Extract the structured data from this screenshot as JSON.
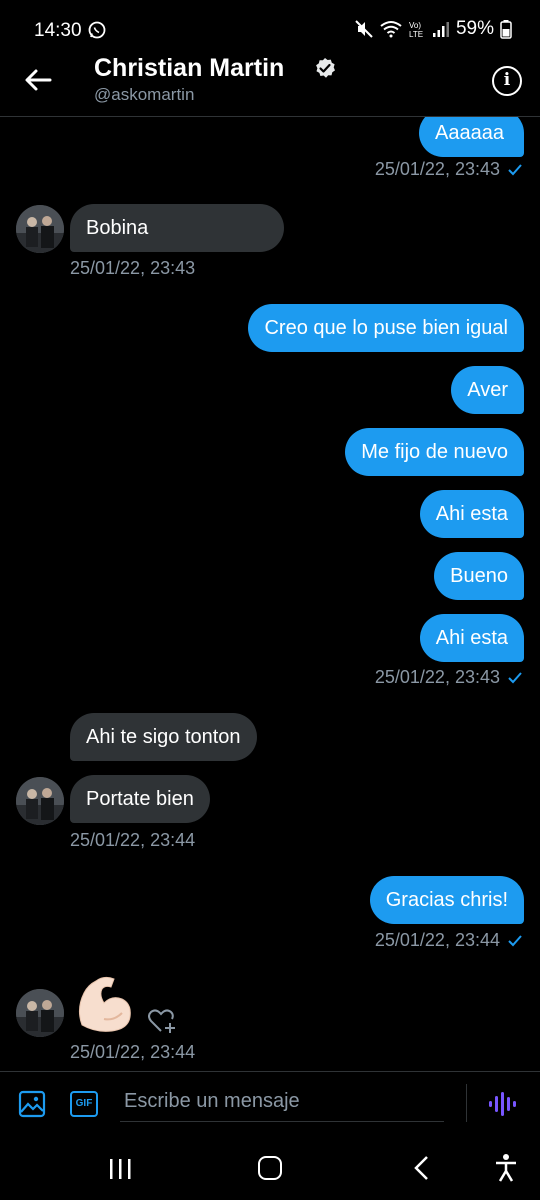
{
  "status_bar": {
    "time": "14:30",
    "battery": "59%",
    "network": "LTE"
  },
  "header": {
    "name": "Christian Martin",
    "handle": "@askomartin"
  },
  "messages": [
    {
      "id": "m1",
      "direction": "out",
      "text": "Aaaaaa"
    },
    {
      "id": "m2",
      "direction": "in",
      "text": "Bobina"
    },
    {
      "id": "m3",
      "direction": "out",
      "text": "Creo que lo puse bien igual"
    },
    {
      "id": "m4",
      "direction": "out",
      "text": "Aver"
    },
    {
      "id": "m5",
      "direction": "out",
      "text": "Me fijo de nuevo"
    },
    {
      "id": "m6",
      "direction": "out",
      "text": "Ahi esta"
    },
    {
      "id": "m7",
      "direction": "out",
      "text": "Bueno"
    },
    {
      "id": "m8",
      "direction": "out",
      "text": "Ahi esta"
    },
    {
      "id": "m9",
      "direction": "in",
      "text": "Ahi te sigo tonton"
    },
    {
      "id": "m10",
      "direction": "in",
      "text": "Portate bien"
    },
    {
      "id": "m11",
      "direction": "out",
      "text": "Gracias chris!"
    },
    {
      "id": "m12",
      "direction": "in",
      "text": "💪"
    }
  ],
  "timestamps": {
    "t1": "25/01/22, 23:43",
    "t2": "25/01/22, 23:43",
    "t3": "25/01/22, 23:43",
    "t4": "25/01/22, 23:44",
    "t5": "25/01/22, 23:44",
    "t6": "25/01/22, 23:44"
  },
  "composer": {
    "placeholder": "Escribe un mensaje",
    "gif_label": "GIF"
  },
  "icons": {
    "back": "arrow-left-icon",
    "verified": "verified-badge-icon",
    "info": "info-icon",
    "image": "image-icon",
    "gif": "gif-icon",
    "voice": "voice-wave-icon",
    "react": "heart-plus-icon"
  },
  "colors": {
    "accent": "#1d9bf0",
    "incoming_bubble": "#2f3336",
    "muted_text": "#8b98a5",
    "voice": "#7856ff",
    "background": "#000000"
  }
}
